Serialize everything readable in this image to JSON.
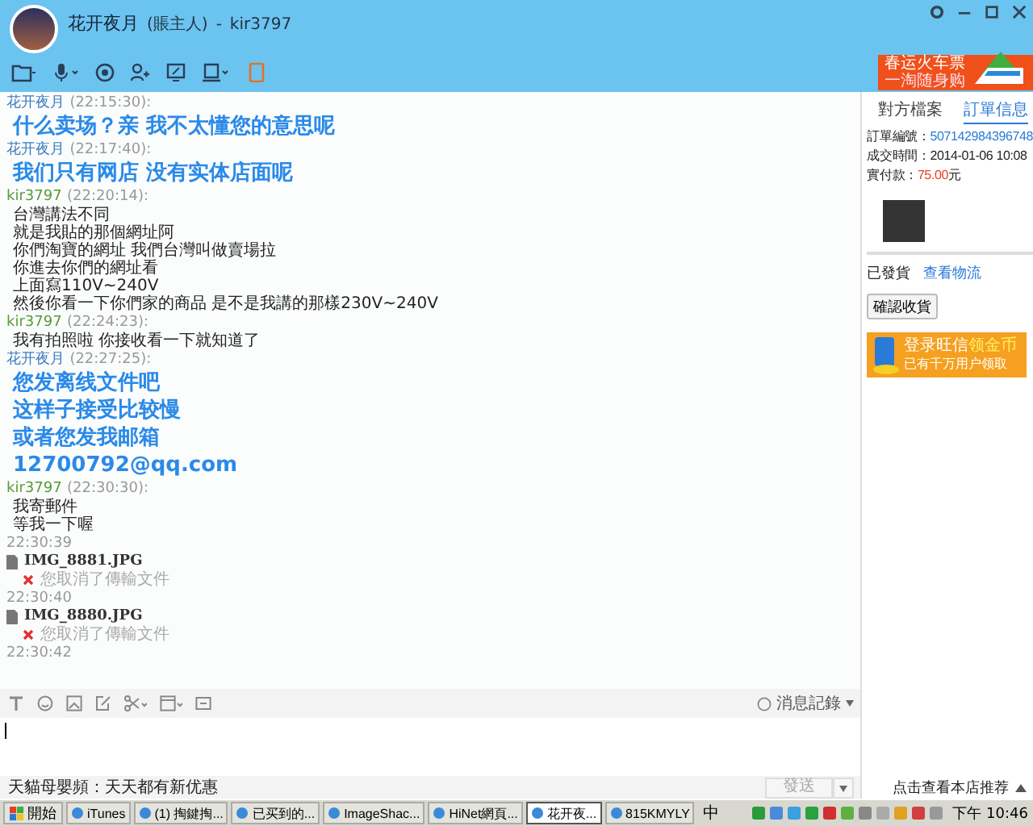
{
  "header": {
    "name": "花开夜月",
    "role": "(賬主人)",
    "separator": "-",
    "account": "kir3797"
  },
  "banner": {
    "title": "春运火车票",
    "subtitle": "一淘随身购"
  },
  "messages": [
    {
      "kind": "text",
      "sender": "花开夜月",
      "color": "#3a7ac0",
      "time": "(22:15:30):",
      "big": true,
      "lines": [
        "什么卖场？亲 我不太懂您的意思呢"
      ]
    },
    {
      "kind": "text",
      "sender": "花开夜月",
      "color": "#3a7ac0",
      "time": "(22:17:40):",
      "big": true,
      "lines": [
        "我们只有网店 没有实体店面呢"
      ]
    },
    {
      "kind": "text",
      "sender": "kir3797",
      "color": "#5a9a3a",
      "time": "(22:20:14):",
      "big": false,
      "lines": [
        "台灣講法不同",
        "就是我貼的那個網址阿",
        "你們淘寶的網址 我們台灣叫做賣場拉",
        "你進去你們的網址看",
        "上面寫110V~240V",
        "然後你看一下你們家的商品 是不是我講的那樣230V~240V"
      ]
    },
    {
      "kind": "text",
      "sender": "kir3797",
      "color": "#5a9a3a",
      "time": "(22:24:23):",
      "big": false,
      "lines": [
        "我有拍照啦 你接收看一下就知道了"
      ]
    },
    {
      "kind": "text",
      "sender": "花开夜月",
      "color": "#3a7ac0",
      "time": "(22:27:25):",
      "big": true,
      "lines": [
        "您发离线文件吧",
        "这样子接受比较慢",
        "或者您发我邮箱",
        "12700792@qq.com"
      ]
    },
    {
      "kind": "text",
      "sender": "kir3797",
      "color": "#5a9a3a",
      "time": "(22:30:30):",
      "big": false,
      "lines": [
        "我寄郵件",
        "等我一下喔"
      ]
    },
    {
      "kind": "file",
      "time": "22:30:39",
      "file": "IMG_8881.JPG",
      "status": "您取消了傳輸文件"
    },
    {
      "kind": "file",
      "time": "22:30:40",
      "file": "IMG_8880.JPG",
      "status": "您取消了傳輸文件"
    },
    {
      "kind": "time",
      "time": "22:30:42"
    }
  ],
  "history_button": "消息記錄",
  "footer_notice": "天貓母嬰頻：天天都有新优惠",
  "send_button": "發送",
  "side_tabs": [
    {
      "label": "對方檔案",
      "selected": false
    },
    {
      "label": "訂單信息",
      "selected": true
    }
  ],
  "order": {
    "number_label": "訂單編號：",
    "number": "507142984396748",
    "time_label": "成交時間：",
    "time": "2014-01-06 10:08",
    "paid_label": "實付款：",
    "paid": "75.00",
    "currency": "元"
  },
  "shipping": {
    "status": "已發貨",
    "link": "查看物流"
  },
  "confirm_button": "確認收貨",
  "promo": {
    "title": "登录旺信",
    "highlight": "领金币",
    "subtitle": "已有千万用户领取"
  },
  "recommend_link": "点击查看本店推荐",
  "taskbar": {
    "start": "開始",
    "items": [
      {
        "label": "iTunes",
        "selected": false
      },
      {
        "label": "(1) 掏鍵掏...",
        "selected": false
      },
      {
        "label": "已买到的...",
        "selected": false
      },
      {
        "label": "ImageShac...",
        "selected": false
      },
      {
        "label": "HiNet網頁...",
        "selected": false
      },
      {
        "label": "花开夜...",
        "selected": true
      },
      {
        "label": "815KMYLY",
        "selected": false
      }
    ],
    "ime": "中",
    "clock": "下午 10:46"
  }
}
